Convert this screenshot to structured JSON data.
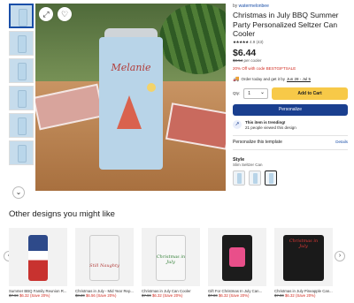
{
  "gallery": {
    "thumb_count": 6,
    "nav_arrow": "chevron-down-icon"
  },
  "hero": {
    "personalized_name": "Melanie",
    "icons": [
      "zoom-icon",
      "heart-icon"
    ]
  },
  "product": {
    "by_prefix": "by",
    "seller": "watermelonbee",
    "title": "Christmas in July BBQ Summer Party Personalized Seltzer Can Cooler",
    "stars": "★★★★★",
    "rating": "4.9 (43)",
    "price": "$6.44",
    "old_price": "$8.54",
    "price_unit": "per cooler",
    "promo": "20% Off with code BESTGIFTSALE",
    "delivery_prefix": "Order today and get it by",
    "delivery_dates": "Jun 28 - Jul 5",
    "qty_label": "Qty:",
    "qty_value": "1",
    "add_to_cart": "Add to Cart",
    "personalize": "Personalize",
    "trending_title": "This item is trending!",
    "trending_sub": "21 people viewed this design",
    "personalize_template": "Personalize this template",
    "details": "Details",
    "style_label": "Style",
    "style_value": "Slim Seltzer Can"
  },
  "other": {
    "heading": "Other designs you might like",
    "cards": [
      {
        "name": "Summer BBQ Family Reunion R...",
        "old": "$7.90",
        "new": "$6.32",
        "sale": "(Save 20%)"
      },
      {
        "name": "Christmas in July - Mid Year Rep...",
        "old": "$8.20",
        "new": "$6.56",
        "sale": "(Save 20%)"
      },
      {
        "name": "Christmas in July Can Cooler",
        "old": "$7.90",
        "new": "$6.32",
        "sale": "(Save 20%)"
      },
      {
        "name": "Gift For Christmas In July Can...",
        "old": "$7.90",
        "new": "$6.32",
        "sale": "(Save 20%)"
      },
      {
        "name": "Christmas in July Pineapple Can...",
        "old": "$7.90",
        "new": "$6.32",
        "sale": "(Save 20%)"
      }
    ],
    "card_texts": [
      "",
      "Still Naughty",
      "Christmas in July",
      "",
      "Christmas in July"
    ]
  }
}
